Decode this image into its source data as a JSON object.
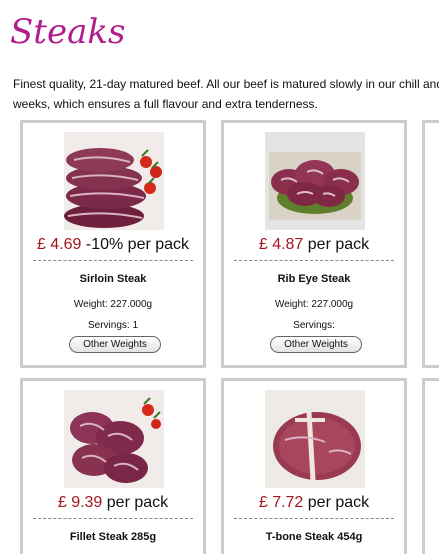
{
  "page": {
    "title": "Steaks",
    "intro_line1": "Finest quality, 21-day matured beef. All our beef is matured slowly in our chill and",
    "intro_line2": "weeks, which ensures a full flavour and extra tenderness."
  },
  "products": [
    {
      "price": "£ 4.69",
      "price_suffix": " -10% per pack",
      "name": "Sirloin Steak",
      "weight": "Weight: 227.000g",
      "servings": "Servings: 1",
      "button": "Other Weights"
    },
    {
      "price": "£ 4.87",
      "price_suffix": " per pack",
      "name": "Rib Eye Steak",
      "weight": "Weight: 227.000g",
      "servings": "Servings:",
      "button": "Other Weights"
    },
    {
      "price": "£ 9.39",
      "price_suffix": " per pack",
      "name": "Fillet Steak 285g"
    },
    {
      "price": "£ 7.72",
      "price_suffix": " per pack",
      "name": "T-bone Steak 454g"
    }
  ],
  "colors": {
    "title": "#b01d8c",
    "price": "#a3161d",
    "card_border": "#cccccc"
  }
}
